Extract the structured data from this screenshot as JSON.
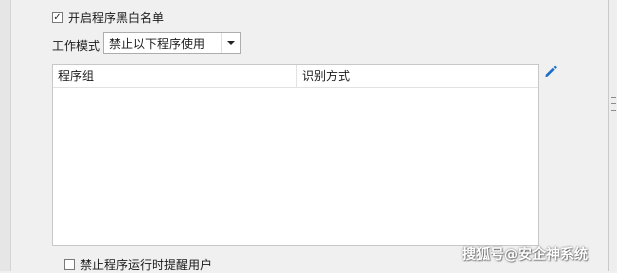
{
  "whitelist": {
    "label": "开启程序黑白名单",
    "checked": true
  },
  "work_mode": {
    "label": "工作模式",
    "selected": "禁止以下程序使用"
  },
  "table": {
    "columns": [
      "程序组",
      "识别方式"
    ],
    "rows": []
  },
  "edit_icon": "pencil-icon",
  "prompt_user": {
    "label": "禁止程序运行时提醒用户",
    "checked": false
  },
  "watermark": "搜狐号@安企神系统",
  "colors": {
    "accent": "#1a6fc9",
    "background": "#f0f0f0"
  }
}
